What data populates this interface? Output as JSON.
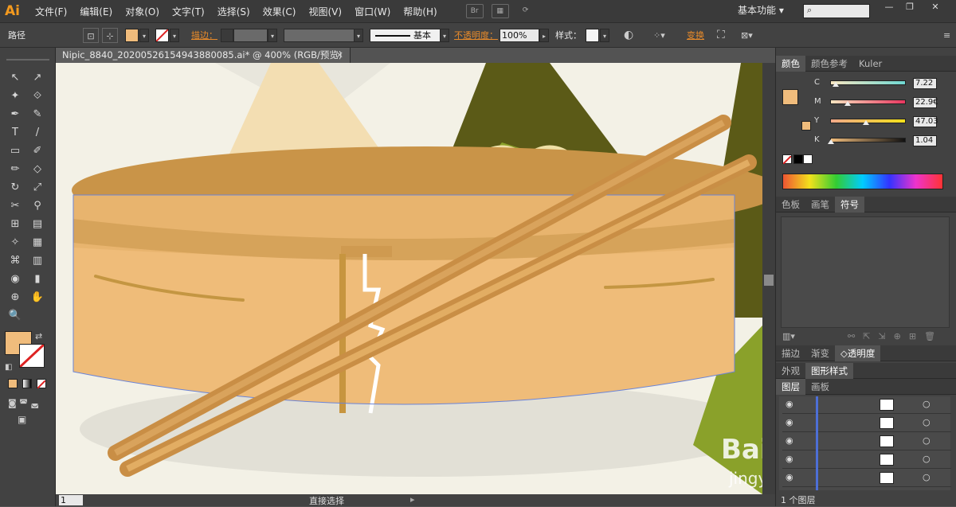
{
  "app": {
    "logo": "Ai"
  },
  "menu": [
    "文件(F)",
    "编辑(E)",
    "对象(O)",
    "文字(T)",
    "选择(S)",
    "效果(C)",
    "视图(V)",
    "窗口(W)",
    "帮助(H)"
  ],
  "menubar_icons": {
    "bridge": "Br",
    "arrange": "▦",
    "sync": "⟳"
  },
  "workspace": {
    "label": "基本功能",
    "arrow": "▾"
  },
  "search": {
    "placeholder": "⌕"
  },
  "window_controls": [
    "—",
    "❐",
    "✕"
  ],
  "control_bar": {
    "object_label": "路径",
    "fill_color": "#f0bc7c",
    "stroke_label": "描边：",
    "stroke_style_label": "基本",
    "opacity_label": "不透明度：",
    "opacity_value": "100%",
    "style_label": "样式：",
    "transform_label": "变换"
  },
  "document": {
    "tab_title": "Nipic_8840_20200526154943880085.ai* @ 400% (RGB/预览)",
    "close": "✕"
  },
  "tools": [
    "↖",
    "↗",
    "✦",
    "⟐",
    "✒",
    "✎",
    "T",
    "/",
    "▭",
    "✐",
    "✏",
    "◇",
    "↻",
    "⤢",
    "✂",
    "⚲",
    "⊞",
    "▤",
    "✧",
    "▦",
    "⌘",
    "▥",
    "◉",
    "▮",
    "⊕",
    "✋",
    "🔍"
  ],
  "status_bar": {
    "zoom": "1",
    "tool": "直接选择"
  },
  "colors_panel": {
    "tabs": [
      "颜色",
      "颜色参考",
      "Kuler"
    ],
    "active_tab": 0,
    "channels": [
      {
        "label": "C",
        "value": "7.22",
        "fraction": 0.07
      },
      {
        "label": "M",
        "value": "22.9€",
        "fraction": 0.23
      },
      {
        "label": "Y",
        "value": "47.03",
        "fraction": 0.47
      },
      {
        "label": "K",
        "value": "1.04",
        "fraction": 0.01
      }
    ],
    "fill_color": "#f0bc7c"
  },
  "swatches_panel": {
    "tabs": [
      "色板",
      "画笔",
      "符号"
    ],
    "active_tab": 2
  },
  "transparency_panel": {
    "tabs": [
      "描边",
      "渐变",
      "◇透明度"
    ],
    "active_tab": 2
  },
  "appearance_panel": {
    "tabs": [
      "外观",
      "图形样式"
    ],
    "active_tab": 1
  },
  "layers_panel": {
    "tabs": [
      "图层",
      "画板"
    ],
    "active_tab": 0,
    "footer": "1 个图层"
  },
  "watermark": {
    "text": "Bai 经验",
    "sub": "jingyan.b"
  }
}
